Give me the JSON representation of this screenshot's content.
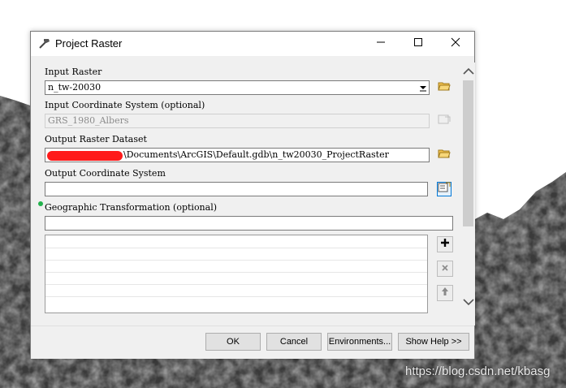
{
  "window": {
    "title": "Project Raster"
  },
  "params": {
    "input_raster": {
      "label": "Input Raster",
      "value": "n_tw-20030"
    },
    "input_coord": {
      "label": "Input Coordinate System (optional)",
      "value": "GRS_1980_Albers"
    },
    "output_raster": {
      "label": "Output Raster Dataset",
      "value_visible": "\\Documents\\ArcGIS\\Default.gdb\\n_tw20030_ProjectRaster"
    },
    "output_coord": {
      "label": "Output Coordinate System",
      "value": ""
    },
    "geo_transform": {
      "label": "Geographic Transformation (optional)",
      "value": ""
    }
  },
  "footer": {
    "ok": "OK",
    "cancel": "Cancel",
    "environments": "Environments...",
    "show_help": "Show Help >>"
  },
  "watermark": "https://blog.csdn.net/kbasg",
  "colors": {
    "accent": "#0078d7",
    "required_dot": "#22b14c",
    "redaction": "#ff1a1a"
  }
}
